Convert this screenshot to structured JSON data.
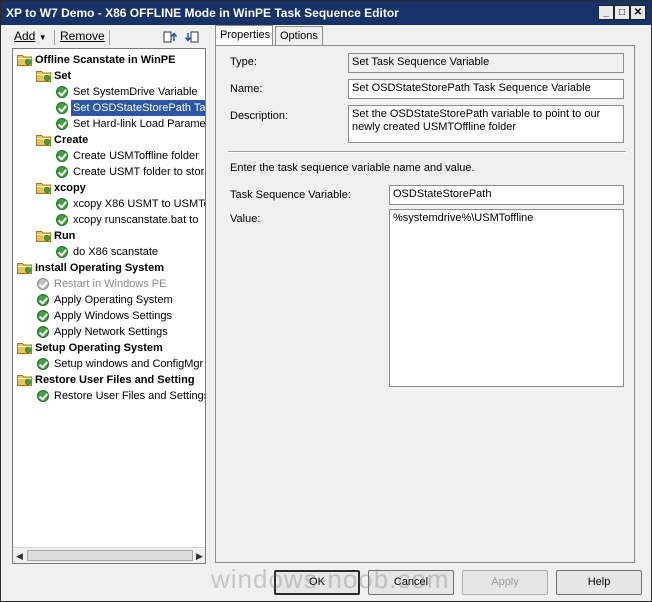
{
  "window": {
    "title": "XP to W7 Demo - X86 OFFLINE Mode in WinPE Task Sequence Editor"
  },
  "toolbar": {
    "add_label": "Add",
    "remove_label": "Remove"
  },
  "tree": {
    "items": [
      {
        "label": "Offline Scanstate in WinPE",
        "kind": "group",
        "level": 0
      },
      {
        "label": "Set",
        "kind": "group",
        "level": 1
      },
      {
        "label": "Set SystemDrive Variable",
        "kind": "step",
        "level": 2
      },
      {
        "label": "Set OSDStateStorePath Ta",
        "kind": "step",
        "level": 2,
        "selected": true
      },
      {
        "label": "Set Hard-link Load Paramet",
        "kind": "step",
        "level": 2
      },
      {
        "label": "Create",
        "kind": "group",
        "level": 1
      },
      {
        "label": "Create USMToffline folder",
        "kind": "step",
        "level": 2
      },
      {
        "label": "Create USMT folder to stor",
        "kind": "step",
        "level": 2
      },
      {
        "label": "xcopy",
        "kind": "group",
        "level": 1
      },
      {
        "label": "xcopy X86 USMT to USMTo",
        "kind": "step",
        "level": 2
      },
      {
        "label": "xcopy runscanstate.bat to",
        "kind": "step",
        "level": 2
      },
      {
        "label": "Run",
        "kind": "group",
        "level": 1
      },
      {
        "label": "do X86 scanstate",
        "kind": "step",
        "level": 2
      },
      {
        "label": "Install Operating System",
        "kind": "group",
        "level": 0
      },
      {
        "label": "Restart in Windows PE",
        "kind": "step",
        "level": 1,
        "disabled": true
      },
      {
        "label": "Apply Operating System",
        "kind": "step",
        "level": 1
      },
      {
        "label": "Apply Windows Settings",
        "kind": "step",
        "level": 1
      },
      {
        "label": "Apply Network Settings",
        "kind": "step",
        "level": 1
      },
      {
        "label": "Setup Operating System",
        "kind": "group",
        "level": 0
      },
      {
        "label": "Setup windows and ConfigMgr",
        "kind": "step",
        "level": 1
      },
      {
        "label": "Restore User Files and Setting",
        "kind": "group",
        "level": 0
      },
      {
        "label": "Restore User Files and Settings",
        "kind": "step",
        "level": 1
      }
    ]
  },
  "tabs": {
    "properties": "Properties",
    "options": "Options"
  },
  "properties": {
    "type_label": "Type:",
    "type_value": "Set Task Sequence Variable",
    "name_label": "Name:",
    "name_value": "Set OSDStateStorePath Task Sequence Variable",
    "description_label": "Description:",
    "description_value": "Set the OSDStateStorePath variable to point to our newly created USMTOffline folder",
    "instruction": "Enter the task sequence variable name and value.",
    "variable_label": "Task Sequence Variable:",
    "variable_value": "OSDStateStorePath",
    "value_label": "Value:",
    "value_value": "%systemdrive%\\USMToffline"
  },
  "buttons": {
    "ok": "OK",
    "cancel": "Cancel",
    "apply": "Apply",
    "help": "Help"
  },
  "watermark": "windows-noob.com"
}
